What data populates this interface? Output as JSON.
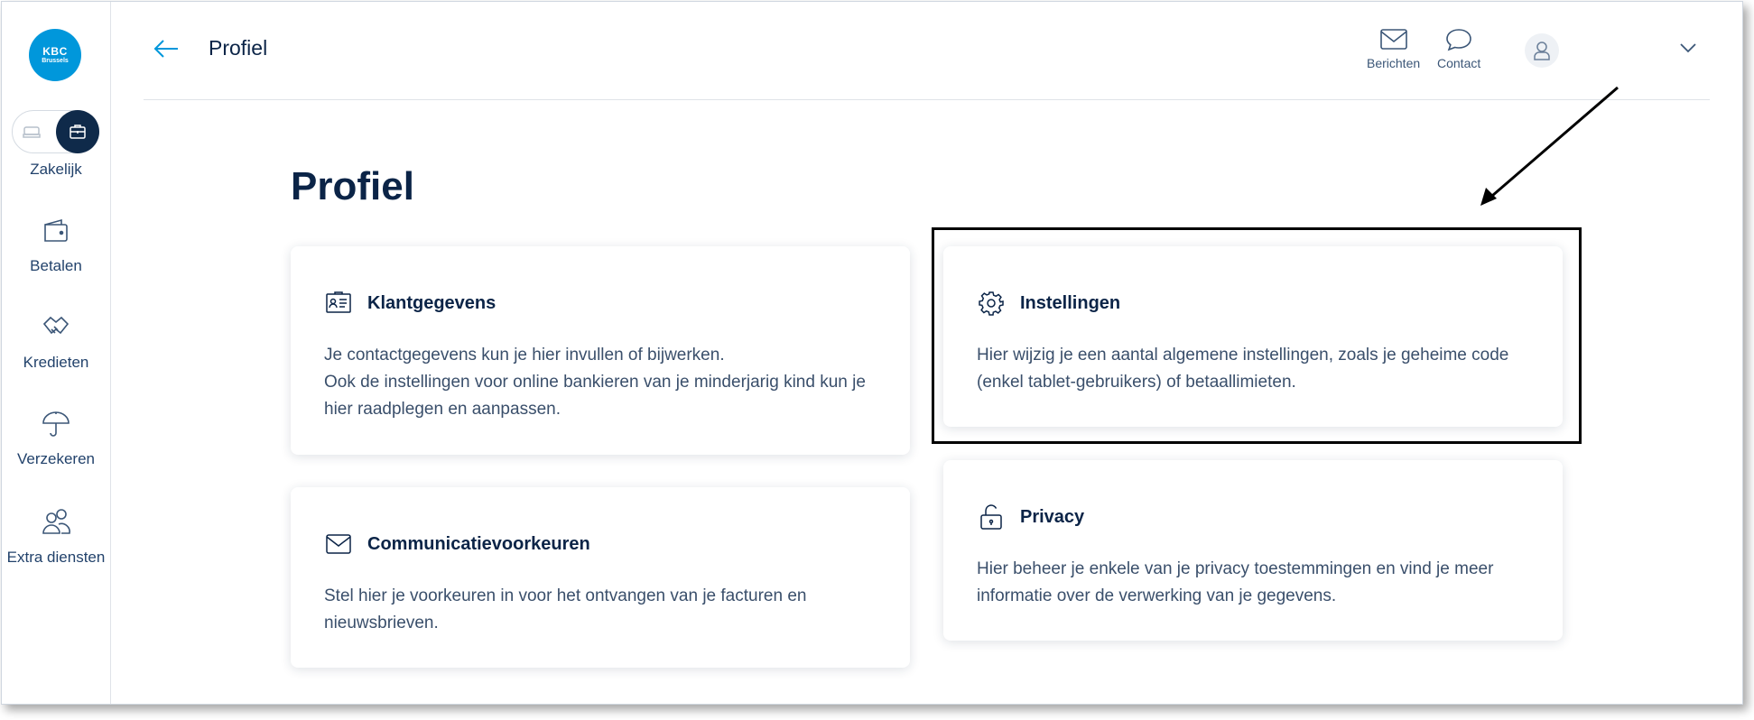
{
  "sidebar": {
    "logo": {
      "line1": "KBC",
      "line2": "Brussels"
    },
    "toggle_label": "Zakelijk",
    "items": [
      {
        "label": "Betalen",
        "icon": "wallet-icon"
      },
      {
        "label": "Kredieten",
        "icon": "handshake-icon"
      },
      {
        "label": "Verzekeren",
        "icon": "umbrella-icon"
      },
      {
        "label": "Extra diensten",
        "icon": "users-icon"
      }
    ]
  },
  "header": {
    "title": "Profiel",
    "messages_label": "Berichten",
    "contact_label": "Contact"
  },
  "main": {
    "title": "Profiel",
    "cards": [
      {
        "title": "Klantgegevens",
        "icon": "id-card-icon",
        "lines": [
          "Je contactgegevens kun je hier invullen of bijwerken.",
          "Ook de instellingen voor online bankieren van je minderjarig kind kun je hier raadplegen en aanpassen."
        ]
      },
      {
        "title": "Instellingen",
        "icon": "gear-icon",
        "lines": [
          "Hier wijzig je een aantal algemene instellingen, zoals je geheime code (enkel tablet-gebruikers) of betaallimieten."
        ]
      },
      {
        "title": "Communicatievoorkeuren",
        "icon": "envelope-icon",
        "lines": [
          "Stel hier je voorkeuren in voor het ontvangen van je facturen en nieuwsbrieven."
        ]
      },
      {
        "title": "Privacy",
        "icon": "unlock-icon",
        "lines": [
          "Hier beheer je enkele van je privacy toestemmingen en vind je meer informatie over de verwerking van je gegevens."
        ]
      }
    ]
  },
  "colors": {
    "accent": "#0097db",
    "navy": "#0b2447",
    "text": "#3a4f6b"
  }
}
